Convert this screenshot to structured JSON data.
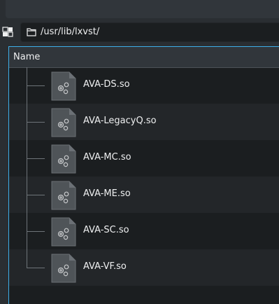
{
  "location": {
    "path": "/usr/lib/lxvst/"
  },
  "columns": {
    "name_header": "Name"
  },
  "files": [
    {
      "name": "AVA-DS.so"
    },
    {
      "name": "AVA-LegacyQ.so"
    },
    {
      "name": "AVA-MC.so"
    },
    {
      "name": "AVA-ME.so"
    },
    {
      "name": "AVA-SC.so"
    },
    {
      "name": "AVA-VF.so"
    }
  ],
  "icons": {
    "view_toggle": "split-view-icon",
    "location": "folder-icon",
    "file": "shared-library-file-icon"
  },
  "colors": {
    "accent": "#3daee9",
    "background": "#1b1e20",
    "alt_row": "#232629",
    "header": "#31363b"
  }
}
